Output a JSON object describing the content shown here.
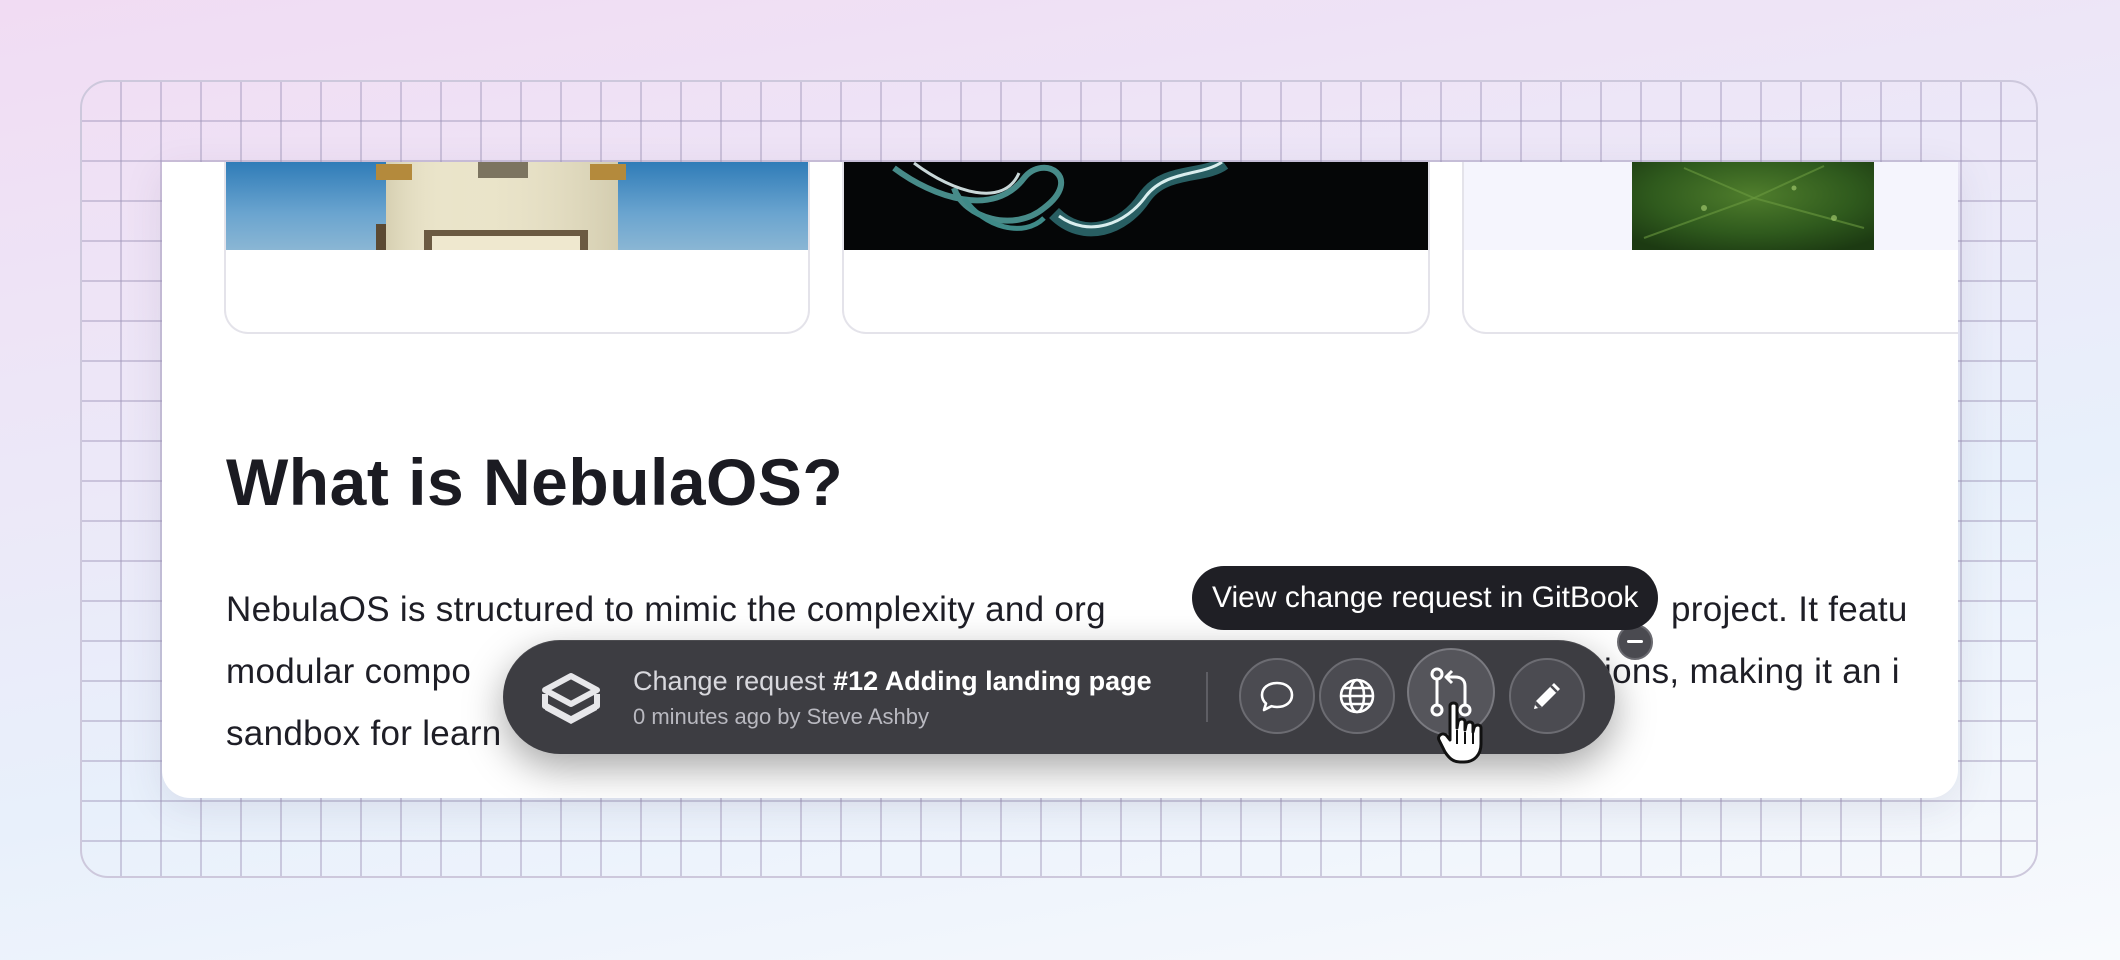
{
  "page": {
    "heading": "What is NebulaOS?",
    "paragraph_lines": [
      "NebulaOS is structured to mimic the complexity and org",
      "project. It featu",
      "modular compo",
      "tions, making it an i",
      "sandbox for learn"
    ]
  },
  "toolbar": {
    "change_request_label": "Change request",
    "change_request_title": "#12 Adding landing page",
    "meta": "0 minutes ago by Steve Ashby",
    "buttons": {
      "comment": "comment-icon",
      "preview": "globe-icon",
      "view_change_request": "branch-pull-icon",
      "edit": "pencil-icon"
    }
  },
  "tooltip": {
    "text": "View change request in GitBook"
  },
  "colors": {
    "toolbar_bg": "#3d3d42",
    "tooltip_bg": "#1f1f25",
    "heading": "#1b1b22"
  }
}
